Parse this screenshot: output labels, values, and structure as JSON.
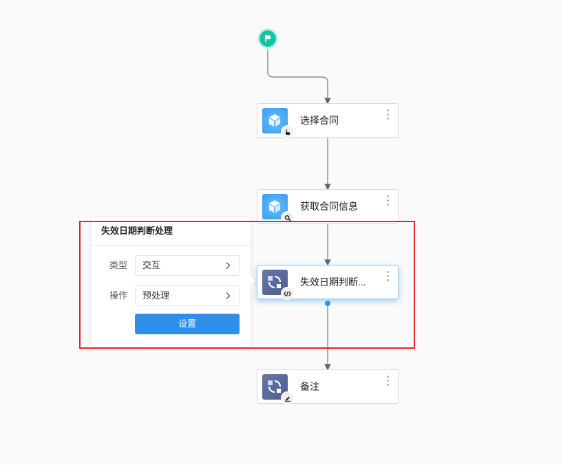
{
  "flow": {
    "start": {
      "icon": "flag-icon"
    },
    "nodes": [
      {
        "id": "select-contract",
        "label": "选择合同",
        "type_icon": "cube-icon",
        "badge_icon": "hand-pointer-icon",
        "style": "blue",
        "selected": false
      },
      {
        "id": "get-contract-info",
        "label": "获取合同信息",
        "type_icon": "cube-icon",
        "badge_icon": "search-icon",
        "style": "blue",
        "selected": false
      },
      {
        "id": "expiry-date-check",
        "label": "失效日期判断...",
        "type_icon": "cycle-icon",
        "badge_icon": "code-icon",
        "style": "slate",
        "selected": true
      },
      {
        "id": "remark",
        "label": "备注",
        "type_icon": "cycle-icon",
        "badge_icon": "edit-icon",
        "style": "slate",
        "selected": false
      }
    ]
  },
  "popover": {
    "title": "失效日期判断处理",
    "fields": [
      {
        "label": "类型",
        "value": "交互"
      },
      {
        "label": "操作",
        "value": "预处理"
      }
    ],
    "button_label": "设置"
  },
  "colors": {
    "start": "#17c3a5",
    "primary": "#2f8ee9",
    "highlight": "#ee2020"
  }
}
